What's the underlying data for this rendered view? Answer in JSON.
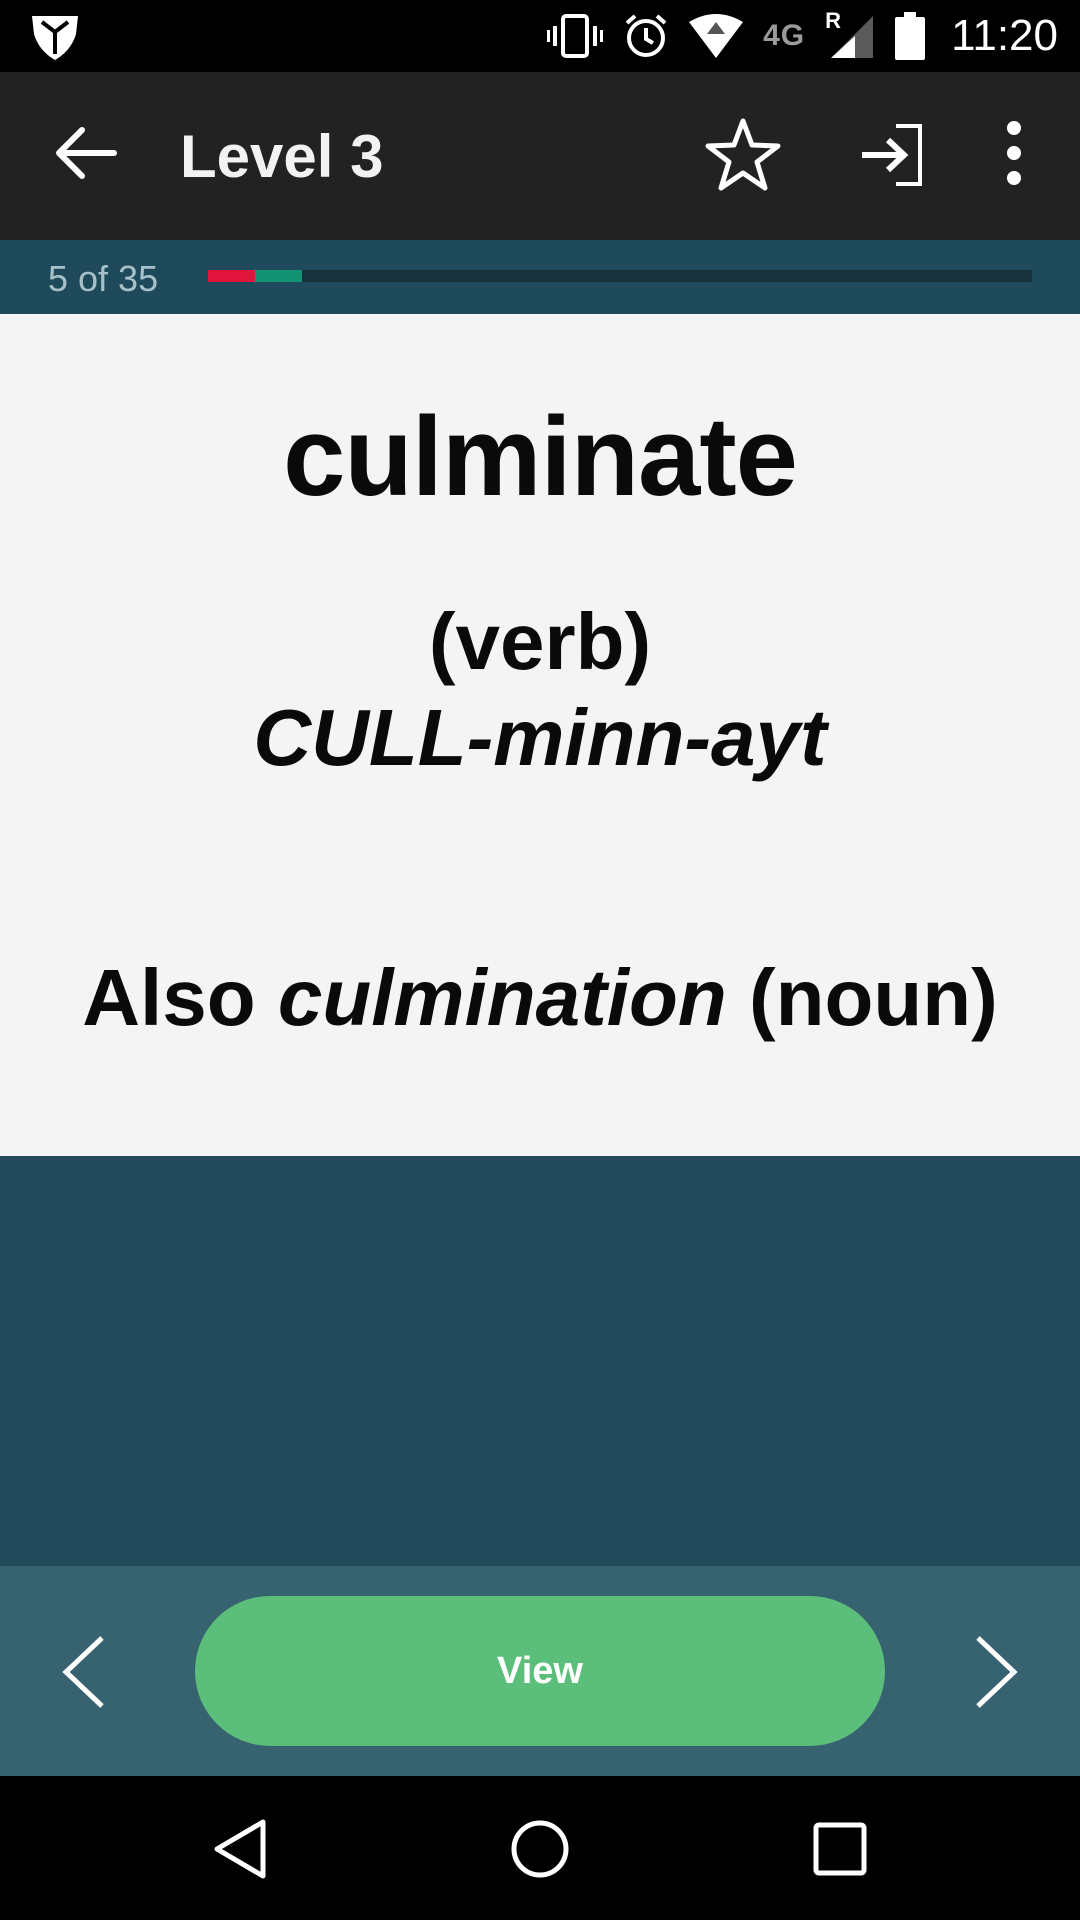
{
  "status_bar": {
    "network_label": "4G",
    "roaming_label": "R",
    "time": "11:20",
    "icons": [
      "shield-icon",
      "vibrate-icon",
      "alarm-icon",
      "wifi-icon",
      "signal-icon",
      "battery-icon"
    ]
  },
  "app_bar": {
    "title": "Level 3",
    "icons": [
      "back-arrow-icon",
      "star-icon",
      "enter-icon",
      "more-vert-icon"
    ]
  },
  "progress": {
    "label": "5 of 35",
    "current": 5,
    "total": 35,
    "red_fraction": 0.057,
    "green_fraction": 0.057,
    "colors": {
      "red": "#e0143c",
      "green": "#129270",
      "track": "#17323d"
    }
  },
  "card": {
    "word": "culminate",
    "part_of_speech": "(verb)",
    "pronunciation": "CULL-minn-ayt",
    "also_prefix": "Also ",
    "also_word": "culmination",
    "also_suffix": " (noun)"
  },
  "actions": {
    "view_label": "View",
    "icons": [
      "chevron-left-icon",
      "chevron-right-icon"
    ],
    "button_color": "#5bbe7b"
  },
  "system_nav": {
    "icons": [
      "nav-back-icon",
      "nav-home-icon",
      "nav-recents-icon"
    ]
  }
}
